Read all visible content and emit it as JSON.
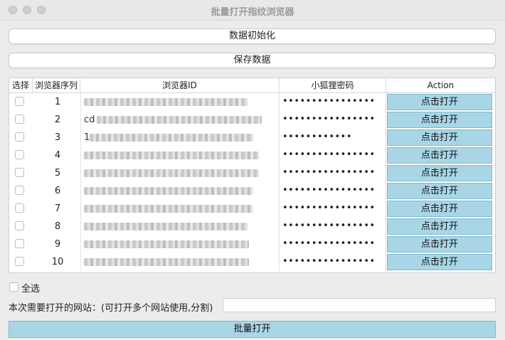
{
  "window": {
    "title": "批量打开指纹浏览器"
  },
  "buttons": {
    "init": "数据初始化",
    "save": "保存数据",
    "batch_open": "批量打开"
  },
  "table": {
    "headers": [
      "选择",
      "浏览器序列",
      "浏览器ID",
      "小狐狸密码",
      "Action"
    ],
    "rows": [
      {
        "seq": "1",
        "id_visible": "",
        "password": "••••••••••••••••",
        "action": "点击打开"
      },
      {
        "seq": "2",
        "id_visible": "cd",
        "password": "••••••••••••••••",
        "action": "点击打开"
      },
      {
        "seq": "3",
        "id_visible": "1",
        "password": "••••••••••••",
        "action": "点击打开"
      },
      {
        "seq": "4",
        "id_visible": "",
        "password": "••••••••••••••••",
        "action": "点击打开"
      },
      {
        "seq": "5",
        "id_visible": "",
        "password": "••••••••••••••••",
        "action": "点击打开"
      },
      {
        "seq": "6",
        "id_visible": "",
        "password": "••••••••••••••••",
        "action": "点击打开"
      },
      {
        "seq": "7",
        "id_visible": "",
        "password": "••••••••••••••••",
        "action": "点击打开"
      },
      {
        "seq": "8",
        "id_visible": "",
        "password": "••••••••••••••••",
        "action": "点击打开"
      },
      {
        "seq": "9",
        "id_visible": "",
        "password": "••••••••••••••••",
        "action": "点击打开"
      },
      {
        "seq": "10",
        "id_visible": "",
        "password": "••••••••••••••••",
        "action": "点击打开"
      }
    ]
  },
  "select_all_label": "全选",
  "url": {
    "label": "本次需要打开的网站：(可打开多个网站使用,分割)",
    "value": ""
  },
  "colors": {
    "action_bg": "#a9d6e6"
  }
}
